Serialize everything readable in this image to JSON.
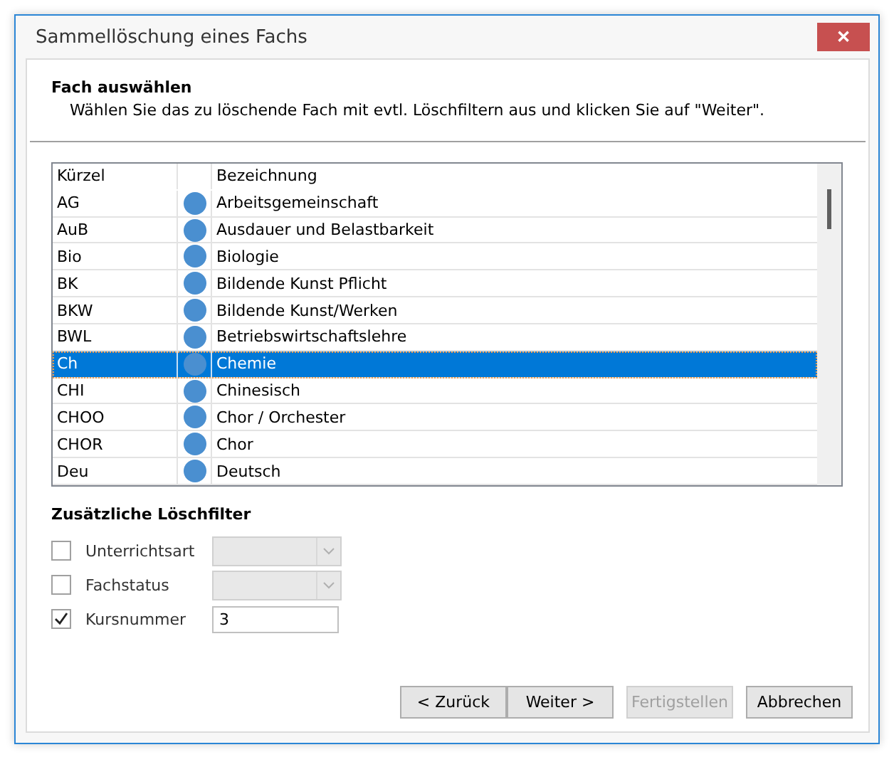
{
  "window": {
    "title": "Sammellöschung eines Fachs",
    "close": "✕"
  },
  "header": {
    "title": "Fach auswählen",
    "description": "Wählen Sie das zu löschende Fach mit evtl. Löschfiltern aus und klicken Sie auf \"Weiter\"."
  },
  "table": {
    "columns": [
      "Kürzel",
      "",
      "Bezeichnung"
    ],
    "rows": [
      {
        "code": "AG",
        "name": "Arbeitsgemeinschaft",
        "selected": false,
        "color": "#4a8fd0"
      },
      {
        "code": "AuB",
        "name": "Ausdauer und Belastbarkeit",
        "selected": false,
        "color": "#4a8fd0"
      },
      {
        "code": "Bio",
        "name": "Biologie",
        "selected": false,
        "color": "#4a8fd0"
      },
      {
        "code": "BK",
        "name": "Bildende Kunst Pflicht",
        "selected": false,
        "color": "#4a8fd0"
      },
      {
        "code": "BKW",
        "name": "Bildende Kunst/Werken",
        "selected": false,
        "color": "#4a8fd0"
      },
      {
        "code": "BWL",
        "name": "Betriebswirtschaftslehre",
        "selected": false,
        "color": "#4a8fd0"
      },
      {
        "code": "Ch",
        "name": "Chemie",
        "selected": true,
        "color": "#4a8fd0"
      },
      {
        "code": "CHI",
        "name": "Chinesisch",
        "selected": false,
        "color": "#4a8fd0"
      },
      {
        "code": "CHOO",
        "name": "Chor / Orchester",
        "selected": false,
        "color": "#4a8fd0"
      },
      {
        "code": "CHOR",
        "name": "Chor",
        "selected": false,
        "color": "#4a8fd0"
      },
      {
        "code": "Deu",
        "name": "Deutsch",
        "selected": false,
        "color": "#4a8fd0"
      }
    ]
  },
  "filters": {
    "title": "Zusätzliche Löschfilter",
    "items": [
      {
        "kind": "dropdown",
        "label": "Unterrichtsart",
        "checked": false,
        "disabled": true
      },
      {
        "kind": "dropdown",
        "label": "Fachstatus",
        "checked": false,
        "disabled": true
      },
      {
        "kind": "text",
        "label": "Kursnummer",
        "checked": true,
        "value": "3"
      }
    ]
  },
  "buttons": [
    {
      "label": "< Zurück",
      "disabled": false
    },
    {
      "label": "Weiter >",
      "disabled": false
    },
    {
      "label": "Fertigstellen",
      "disabled": true
    },
    {
      "label": "Abbrechen",
      "disabled": false
    }
  ]
}
